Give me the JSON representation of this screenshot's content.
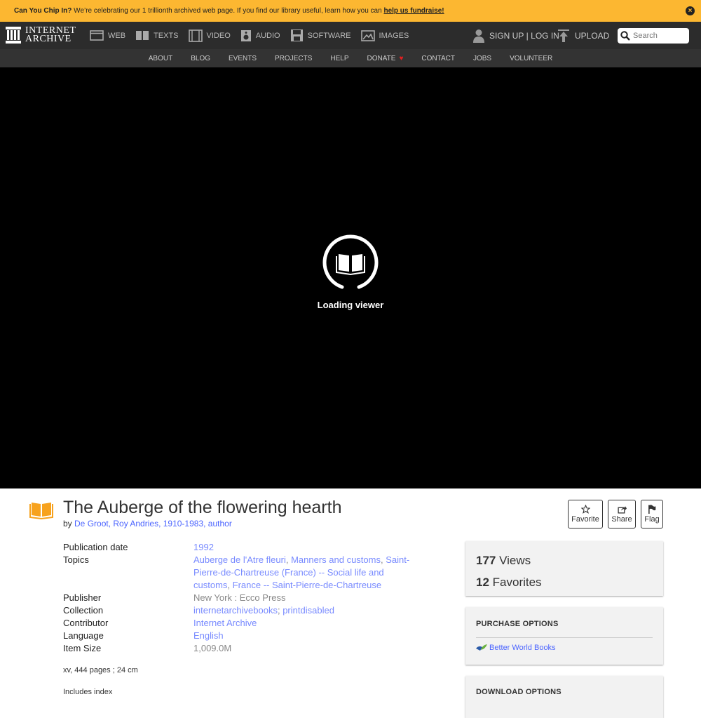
{
  "banner": {
    "bold": "Can You Chip In?",
    "text": " We’re celebrating our 1 trillionth archived web page. If you find our library useful, learn how you can ",
    "link": "help us fundraise!",
    "close": "×"
  },
  "logo": {
    "line1": "INTERNET",
    "line2": "ARCHIVE"
  },
  "mediatypes": [
    {
      "label": "WEB",
      "icon": "web-icon"
    },
    {
      "label": "TEXTS",
      "icon": "texts-icon"
    },
    {
      "label": "VIDEO",
      "icon": "video-icon"
    },
    {
      "label": "AUDIO",
      "icon": "audio-icon"
    },
    {
      "label": "SOFTWARE",
      "icon": "software-icon"
    },
    {
      "label": "IMAGES",
      "icon": "images-icon"
    }
  ],
  "user": {
    "signup": "SIGN UP",
    "sep": " | ",
    "login": "LOG IN",
    "upload": "UPLOAD"
  },
  "search": {
    "placeholder": "Search"
  },
  "subnav": [
    "ABOUT",
    "BLOG",
    "EVENTS",
    "PROJECTS",
    "HELP",
    "DONATE",
    "CONTACT",
    "JOBS",
    "VOLUNTEER"
  ],
  "donate_heart": "♥",
  "viewer": {
    "loading": "Loading viewer"
  },
  "item": {
    "title": "The Auberge of the flowering hearth",
    "by": "by ",
    "author": "De Groot, Roy Andries, 1910-1983, author"
  },
  "actions": {
    "favorite": "Favorite",
    "share": "Share",
    "flag": "Flag"
  },
  "metadata": {
    "pubdate_label": "Publication date",
    "pubdate": "1992",
    "topics_label": "Topics",
    "topic1": "Auberge de l'Atre fleuri",
    "topic2": "Manners and customs",
    "topic3": "Saint-Pierre-de-Chartreuse (France) -- Social life and customs",
    "topic4": "France -- Saint-Pierre-de-Chartreuse",
    "comma": ", ",
    "publisher_label": "Publisher",
    "publisher": "New York : Ecco Press",
    "collection_label": "Collection",
    "collection1": "internetarchivebooks",
    "collection_sep": "; ",
    "collection2": "printdisabled",
    "contributor_label": "Contributor",
    "contributor": "Internet Archive",
    "language_label": "Language",
    "language": "English",
    "size_label": "Item Size",
    "size": "1,009.0M",
    "pages": "xv, 444 pages ; 24 cm",
    "index": "Includes index"
  },
  "stats": {
    "views_num": "177",
    "views_label": " Views",
    "fav_num": "12",
    "fav_label": " Favorites"
  },
  "purchase": {
    "heading": "PURCHASE OPTIONS",
    "bwb": "Better World Books"
  },
  "download": {
    "heading": "DOWNLOAD OPTIONS"
  },
  "colors": {
    "banner": "#fcb731",
    "nav": "#2c2c2c",
    "link": "#4b64ff",
    "accent": "#f7a21e"
  }
}
